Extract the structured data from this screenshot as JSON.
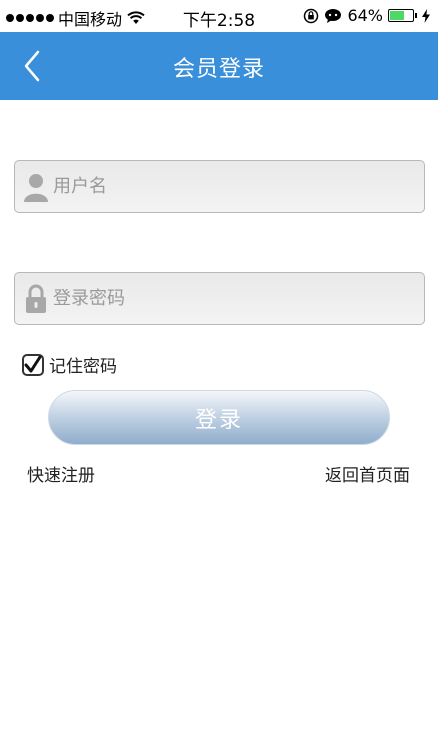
{
  "status_bar": {
    "carrier": "中国移动",
    "time": "下午2:58",
    "battery_percent": "64%",
    "battery_level": 0.64,
    "icons": [
      "signal-dots-icon",
      "wifi-icon",
      "rotation-lock-icon",
      "message-icon",
      "battery-icon",
      "charging-bolt-icon"
    ]
  },
  "nav": {
    "title": "会员登录",
    "back_icon": "chevron-left-icon",
    "color": "#3a8fdb"
  },
  "form": {
    "username_placeholder": "用户名",
    "password_placeholder": "登录密码",
    "username_icon": "user-icon",
    "password_icon": "lock-icon",
    "remember_label": "记住密码",
    "remember_checked": true,
    "login_label": "登录"
  },
  "links": {
    "register": "快速注册",
    "home": "返回首页面"
  }
}
